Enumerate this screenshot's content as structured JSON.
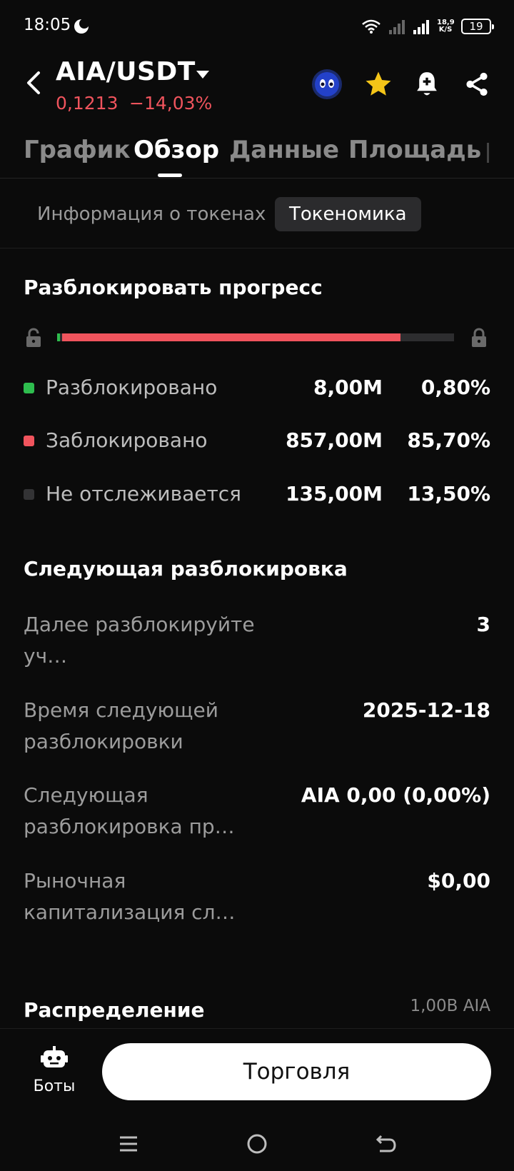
{
  "status_bar": {
    "time": "18:05",
    "net_speed_value": "18,9",
    "net_speed_unit": "K/S",
    "battery": "19"
  },
  "header": {
    "pair": "AIA/USDT",
    "price": "0,1213",
    "change": "−14,03%",
    "price_color": "#f0545d",
    "icons": [
      "back-icon",
      "caret-down-icon",
      "token-avatar-icon",
      "star-icon",
      "bell-plus-icon",
      "share-icon"
    ]
  },
  "tabs": [
    {
      "label": "График",
      "active": false
    },
    {
      "label": "Обзор",
      "active": true
    },
    {
      "label": "Данные",
      "active": false
    },
    {
      "label": "Площадь",
      "active": false
    }
  ],
  "subtabs": [
    {
      "label": "Информация о токенах",
      "active": false
    },
    {
      "label": "Токеномика",
      "active": true
    }
  ],
  "unlock_progress": {
    "title": "Разблокировать прогресс",
    "unlocked_fraction": 0.008,
    "locked_fraction": 0.857,
    "untracked_fraction": 0.135,
    "colors": {
      "unlocked": "#2ebd4e",
      "locked": "#f0545d",
      "untracked": "#2d2d2f"
    },
    "legend": [
      {
        "label": "Разблокировано",
        "amount": "8,00M",
        "percent": "0,80%",
        "color": "#2ebd4e"
      },
      {
        "label": "Заблокировано",
        "amount": "857,00M",
        "percent": "85,70%",
        "color": "#f0545d"
      },
      {
        "label": "Не отслеживается",
        "amount": "135,00M",
        "percent": "13,50%",
        "color": "#333335"
      }
    ]
  },
  "next_unlock": {
    "title": "Следующая разблокировка",
    "rows": [
      {
        "label": "Далее разблокируйте уч…",
        "value": "3"
      },
      {
        "label": "Время следующей разблокировки",
        "value": "2025-12-18"
      },
      {
        "label": "Следующая разблокировка пр…",
        "value": "AIA 0,00 (0,00%)"
      },
      {
        "label": "Рыночная капитализация сл…",
        "value": "$0,00"
      }
    ]
  },
  "distribution": {
    "title": "Распределение",
    "total": "1,00B AIA"
  },
  "bottom": {
    "bots_label": "Боты",
    "trade_label": "Торговля"
  },
  "nav": [
    "menu-icon",
    "home-icon",
    "back-nav-icon"
  ]
}
